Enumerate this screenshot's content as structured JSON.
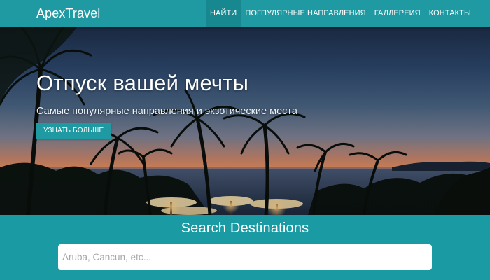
{
  "navbar": {
    "brand": "ApexTravel",
    "links": [
      {
        "label": "НАЙТИ",
        "active": true
      },
      {
        "label": "ПОГПУЛЯРНЫЕ НАПРАВЛЕНИЯ",
        "active": false
      },
      {
        "label": "ГАЛЛЕРЕИЯ",
        "active": false
      },
      {
        "label": "КОНТАКТЫ",
        "active": false
      }
    ]
  },
  "hero": {
    "title": "Отпуск вашей мечты",
    "subtitle": "Самые популярные направления и экзотические места",
    "button_label": "УЗНАТЬ БОЛЬШЕ"
  },
  "search": {
    "title": "Search Destinations",
    "placeholder": "Aruba, Cancun, etc..."
  },
  "colors": {
    "accent": "#1f9aa2",
    "accent_active": "#178890",
    "section_bg": "#1a9aa3"
  }
}
